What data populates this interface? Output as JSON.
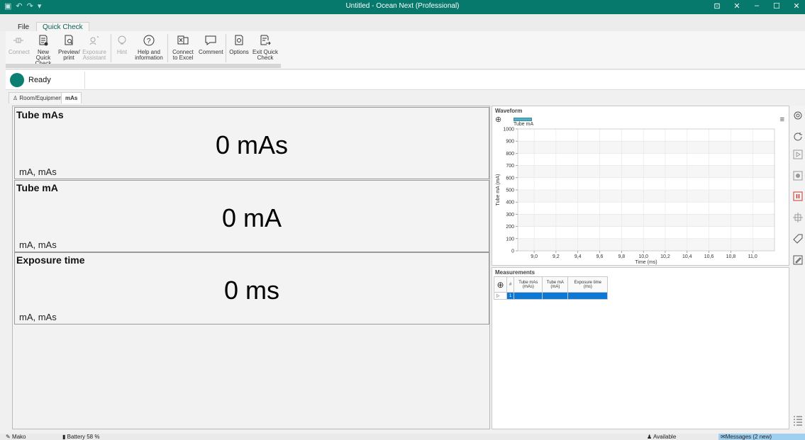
{
  "window": {
    "title": "Untitled - Ocean Next (Professional)",
    "controls": [
      "⊡",
      "✕",
      "–",
      "☐",
      "✕"
    ]
  },
  "menu": {
    "file": "File",
    "quick_check": "Quick Check"
  },
  "ribbon": {
    "buttons": [
      {
        "label": "Connect",
        "icon": "connect-icon",
        "enabled": false
      },
      {
        "label": "New Quick Check",
        "icon": "new-document-icon",
        "enabled": true
      },
      {
        "label": "Preview/ print",
        "icon": "print-preview-icon",
        "enabled": true
      },
      {
        "label": "Exposure Assistant",
        "icon": "assistant-icon",
        "enabled": false
      },
      {
        "label": "Hint",
        "icon": "hint-icon",
        "enabled": false
      },
      {
        "label": "Help and information",
        "icon": "help-icon",
        "enabled": true
      },
      {
        "label": "Connect to Excel",
        "icon": "excel-icon",
        "enabled": true
      },
      {
        "label": "Comment",
        "icon": "comment-icon",
        "enabled": true
      },
      {
        "label": "Options",
        "icon": "options-icon",
        "enabled": true
      },
      {
        "label": "Exit Quick Check",
        "icon": "exit-icon",
        "enabled": true
      }
    ]
  },
  "status": {
    "text": "Ready",
    "color": "#0b7f71"
  },
  "doc_tabs": [
    {
      "label": "Room/Equipment",
      "icon": "room-icon",
      "active": false
    },
    {
      "label": "mAs",
      "active": true
    }
  ],
  "measurements_display": [
    {
      "title": "Tube mAs",
      "value": "0",
      "unit_label": "mAs",
      "sub": "mA, mAs"
    },
    {
      "title": "Tube mA",
      "value": "0",
      "unit_label": "mA",
      "sub": "mA, mAs"
    },
    {
      "title": "Exposure time",
      "value": "0",
      "unit_label": "ms",
      "sub": "mA, mAs"
    }
  ],
  "waveform": {
    "heading": "Waveform",
    "legend": "Tube mA",
    "color": "#52b0c4"
  },
  "chart_data": {
    "type": "line",
    "xlabel": "Time (ms)",
    "ylabel": "Tube mA  (mA)",
    "xlim": [
      8.85,
      11.2
    ],
    "ylim": [
      0,
      1000
    ],
    "x_ticks": [
      "9,0",
      "9,2",
      "9,4",
      "9,6",
      "9,8",
      "10,0",
      "10,2",
      "10,4",
      "10,6",
      "10,8",
      "11,0"
    ],
    "x_tick_values": [
      9.0,
      9.2,
      9.4,
      9.6,
      9.8,
      10.0,
      10.2,
      10.4,
      10.6,
      10.8,
      11.0
    ],
    "y_ticks": [
      0,
      100,
      200,
      300,
      400,
      500,
      600,
      700,
      800,
      900,
      1000
    ],
    "grid": true,
    "series": [
      {
        "name": "Tube mA",
        "x": [],
        "y": []
      }
    ]
  },
  "measurements_table": {
    "heading": "Measurements",
    "columns": [
      "#",
      "Tube mAs (mAs)",
      "Tube mA (mA)",
      "Exposure time (ms)"
    ],
    "rows": [
      [
        "1",
        "",
        "",
        ""
      ]
    ]
  },
  "side_tools": [
    "settings-icon",
    "refresh-icon",
    "play-icon",
    "stop-icon",
    "pause-icon",
    "crosshair-icon",
    "tag-icon",
    "edit-icon",
    "list-icon"
  ],
  "footer": {
    "device": "Mako",
    "battery": "Battery 58 %",
    "available": "Available",
    "messages": "Messages (2 new)"
  }
}
